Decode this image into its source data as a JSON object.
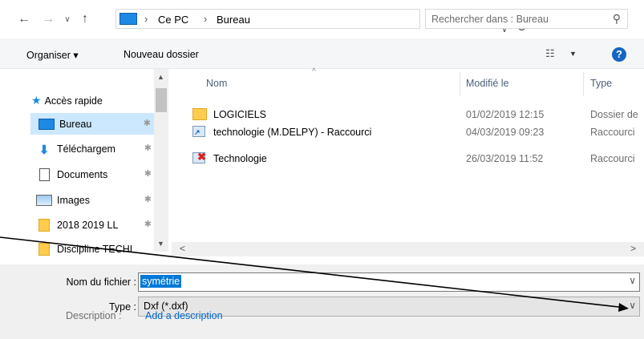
{
  "address_bar": {
    "path": [
      "Ce PC",
      "Bureau"
    ],
    "separator": "›",
    "search_placeholder": "Rechercher dans : Bureau"
  },
  "nav_buttons": {
    "back": "←",
    "forward": "→",
    "recent": "∨",
    "up": "↑",
    "dropdown": "∨",
    "refresh": "↻",
    "search": "⚲"
  },
  "toolbar": {
    "organize_label": "Organiser ▾",
    "new_folder_label": "Nouveau dossier",
    "view_icon": "☷",
    "view_drop": "▼",
    "help_label": "?"
  },
  "nav_pane": {
    "quick_access": "Accès rapide",
    "items": [
      {
        "label": "Bureau",
        "icon": "desktop-icon",
        "pinned": true,
        "selected": true
      },
      {
        "label": "Téléchargem",
        "icon": "download-icon",
        "pinned": true
      },
      {
        "label": "Documents",
        "icon": "document-icon",
        "pinned": true
      },
      {
        "label": "Images",
        "icon": "images-icon",
        "pinned": true
      },
      {
        "label": "2018 2019 LL",
        "icon": "folder-icon",
        "pinned": true
      },
      {
        "label": "Discipline TECHI",
        "icon": "folder-icon",
        "pinned": false
      }
    ],
    "pin_glyph": "✱"
  },
  "file_list": {
    "columns": [
      "Nom",
      "Modifié le",
      "Type"
    ],
    "sort_arrow": "^",
    "rows": [
      {
        "name": "LOGICIELS",
        "date": "01/02/2019 12:15",
        "type": "Dossier de",
        "icon": "folder-icon"
      },
      {
        "name": "technologie (M.DELPY) - Raccourci",
        "date": "04/03/2019 09:23",
        "type": "Raccourci",
        "icon": "shortcut-icon"
      },
      {
        "name": "Technologie",
        "date": "26/03/2019 11:52",
        "type": "Raccourci",
        "icon": "broken-shortcut-icon"
      }
    ]
  },
  "scroll": {
    "up": "▲",
    "down": "▼",
    "left": "<",
    "right": ">"
  },
  "save_fields": {
    "filename_label": "Nom du fichier :",
    "filename_value": "symétrie",
    "type_label": "Type :",
    "type_value": "Dxf (*.dxf)",
    "drop": "∨",
    "description_label": "Description :",
    "description_link": "Add a description"
  },
  "colors": {
    "selection": "#cce8ff",
    "accent": "#0078d7",
    "folder": "#ffcc4d"
  }
}
